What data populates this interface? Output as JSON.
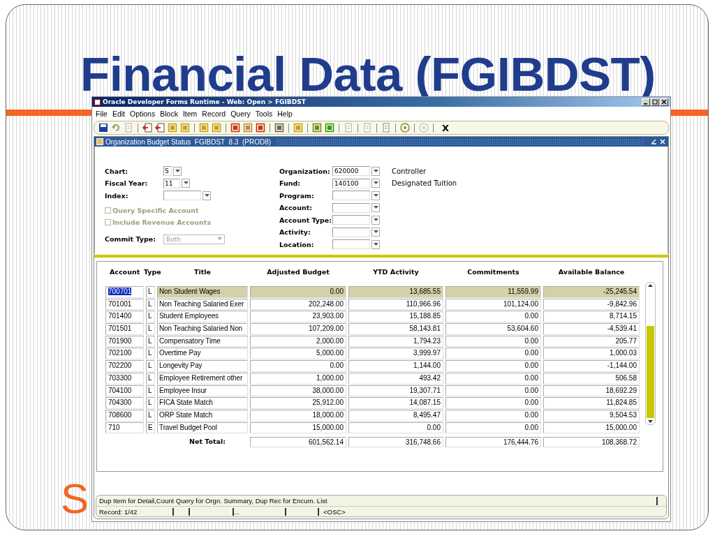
{
  "slide": {
    "title": "Financial Data (FGIBDST)",
    "hidden_text": "S"
  },
  "window": {
    "title": "Oracle Developer Forms Runtime - Web:  Open > FGIBDST"
  },
  "menu": [
    "File",
    "Edit",
    "Options",
    "Block",
    "Item",
    "Record",
    "Query",
    "Tools",
    "Help"
  ],
  "toolbar": {
    "exit_label": "X"
  },
  "form": {
    "title": "Organization Budget Status  FGIBDST  8.3  (PROD8)",
    "left_fields": [
      {
        "label": "Chart:",
        "value": "S",
        "kind": "short"
      },
      {
        "label": "Fiscal Year:",
        "value": "11",
        "kind": "short"
      },
      {
        "label": "Index:",
        "kind": "long"
      }
    ],
    "checkboxes": [
      {
        "label": "Query Specific Account",
        "checked": false,
        "disabled": true
      },
      {
        "label": "Include Revenue Accounts",
        "checked": false,
        "disabled": true
      }
    ],
    "commit_type": {
      "label": "Commit Type:",
      "value": "Both",
      "disabled": true
    },
    "right_fields": [
      {
        "label": "Organization:",
        "value": "620000",
        "description": "Controller"
      },
      {
        "label": "Fund:",
        "value": "140100",
        "description": "Designated Tuition"
      },
      {
        "label": "Program:"
      },
      {
        "label": "Account:"
      },
      {
        "label": "Account Type:"
      },
      {
        "label": "Activity:"
      },
      {
        "label": "Location:"
      }
    ]
  },
  "table": {
    "columns": [
      "Account",
      "Type",
      "Title",
      "Adjusted Budget",
      "YTD Activity",
      "Commitments",
      "Available Balance"
    ],
    "rows": [
      {
        "selected": true,
        "cells": [
          "700701",
          "L",
          "Non Student Wages",
          "0.00",
          "13,685.55",
          "11,559.99",
          "-25,245.54"
        ]
      },
      {
        "selected": false,
        "cells": [
          "701001",
          "L",
          "Non Teaching Salaried Exer",
          "202,248.00",
          "110,966.96",
          "101,124.00",
          "-9,842.96"
        ]
      },
      {
        "selected": false,
        "cells": [
          "701400",
          "L",
          "Student Employees",
          "23,903.00",
          "15,188.85",
          "0.00",
          "8,714.15"
        ]
      },
      {
        "selected": false,
        "cells": [
          "701501",
          "L",
          "Non Teaching Salaried Non",
          "107,209.00",
          "58,143.81",
          "53,604.60",
          "-4,539.41"
        ]
      },
      {
        "selected": false,
        "cells": [
          "701900",
          "L",
          "Compensatory Time",
          "2,000.00",
          "1,794.23",
          "0.00",
          "205.77"
        ]
      },
      {
        "selected": false,
        "cells": [
          "702100",
          "L",
          "Overtime Pay",
          "5,000.00",
          "3,999.97",
          "0.00",
          "1,000.03"
        ]
      },
      {
        "selected": false,
        "cells": [
          "702200",
          "L",
          "Longevity Pay",
          "0.00",
          "1,144.00",
          "0.00",
          "-1,144.00"
        ]
      },
      {
        "selected": false,
        "cells": [
          "703300",
          "L",
          "Employee Retirement other",
          "1,000.00",
          "493.42",
          "0.00",
          "506.58"
        ]
      },
      {
        "selected": false,
        "cells": [
          "704100",
          "L",
          "Employee Insur",
          "38,000.00",
          "19,307.71",
          "0.00",
          "18,692.29"
        ]
      },
      {
        "selected": false,
        "cells": [
          "704300",
          "L",
          "FICA State Match",
          "25,912.00",
          "14,087.15",
          "0.00",
          "11,824.85"
        ]
      },
      {
        "selected": false,
        "cells": [
          "708600",
          "L",
          "ORP State Match",
          "18,000.00",
          "8,495.47",
          "0.00",
          "9,504.53"
        ]
      },
      {
        "selected": false,
        "cells": [
          "710",
          "E",
          "Travel Budget Pool",
          "15,000.00",
          "0.00",
          "0.00",
          "15,000.00"
        ]
      }
    ],
    "total": {
      "label": "Net Total:",
      "values": [
        "601,562.14",
        "316,748.66",
        "176,444.76",
        "108,368.72"
      ]
    }
  },
  "status_bar": {
    "message": "Dup Item for Detail,Count Query for Orgn. Summary, Dup Rec for Encum. List",
    "record": "Record: 1/42",
    "ellipsis": "...",
    "mode": "<OSC>"
  }
}
